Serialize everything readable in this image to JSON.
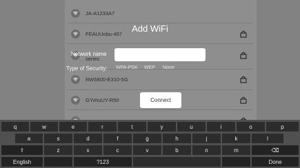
{
  "wifi_list": {
    "rows": [
      {
        "name": "JA-A1233A7",
        "locked": false
      },
      {
        "name": "FEAUUnbu-457",
        "locked": true
      },
      {
        "name": "series",
        "locked": true
      },
      {
        "name": "RW5800-E310-5G",
        "locked": true
      },
      {
        "name": "",
        "locked": true
      },
      {
        "name": "GYvhuUY-R50",
        "locked": true
      },
      {
        "name": "",
        "locked": true
      }
    ]
  },
  "dialog": {
    "title": "Add WiFi",
    "network_name_label": "Network name",
    "network_name_value": "",
    "security_label": "Type of Security:",
    "security_options": [
      "WPA-PSK",
      "WEP",
      "None"
    ],
    "connect_label": "Connect"
  },
  "keyboard": {
    "row1": [
      "q",
      "w",
      "e",
      "r",
      "t",
      "y",
      "u",
      "i",
      "o",
      "p"
    ],
    "row2": [
      "a",
      "s",
      "d",
      "f",
      "g",
      "h",
      "j",
      "k",
      "l"
    ],
    "row3": [
      "⇧",
      "z",
      "x",
      "c",
      "v",
      "b",
      "n",
      "m",
      "⌫"
    ],
    "row4": {
      "language": "English",
      "symbols": "?123",
      "done": "Done"
    }
  }
}
